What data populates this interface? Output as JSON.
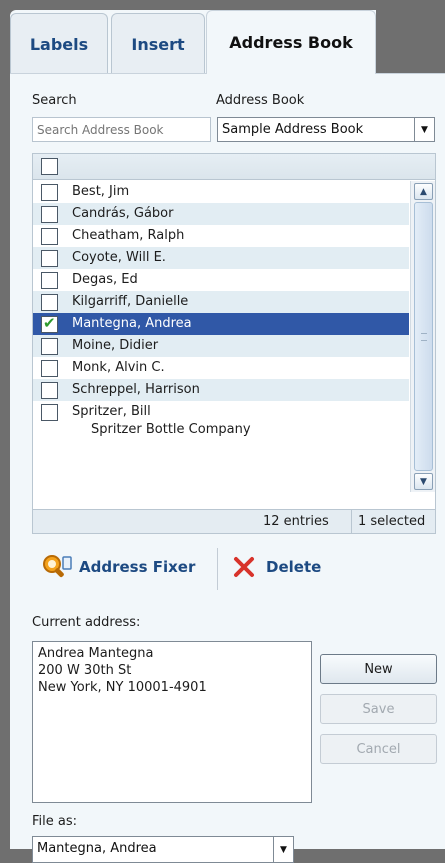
{
  "tabs": [
    {
      "label": "Labels"
    },
    {
      "label": "Insert"
    },
    {
      "label": "Address Book"
    }
  ],
  "search": {
    "label": "Search",
    "placeholder": "Search Address Book"
  },
  "address_book": {
    "label": "Address Book",
    "selected": "Sample Address Book"
  },
  "contacts": [
    {
      "name": "Best, Jim",
      "checked": false
    },
    {
      "name": "Candrás, Gábor",
      "checked": false
    },
    {
      "name": "Cheatham, Ralph",
      "checked": false
    },
    {
      "name": "Coyote, Will E.",
      "checked": false
    },
    {
      "name": "Degas, Ed",
      "checked": false
    },
    {
      "name": "Kilgarriff, Danielle",
      "checked": false
    },
    {
      "name": "Mantegna, Andrea",
      "checked": true
    },
    {
      "name": "Moine, Didier",
      "checked": false
    },
    {
      "name": "Monk, Alvin C.",
      "checked": false
    },
    {
      "name": "Schreppel, Harrison",
      "checked": false
    },
    {
      "name": "Spritzer, Bill",
      "company": "Spritzer Bottle Company",
      "checked": false
    }
  ],
  "list_footer": {
    "entries": "12 entries",
    "selected": "1 selected"
  },
  "actions": {
    "address_fixer": "Address Fixer",
    "delete": "Delete"
  },
  "current_address": {
    "label": "Current address:",
    "lines": [
      "Andrea Mantegna",
      "200 W 30th St",
      "New York, NY 10001-4901"
    ]
  },
  "buttons": {
    "new": "New",
    "save": "Save",
    "cancel": "Cancel"
  },
  "file_as": {
    "label": "File as:",
    "value": "Mantegna, Andrea"
  },
  "colors": {
    "tab_text": "#1d4a82",
    "selected_row": "#3058a7",
    "delete_icon": "#d8332b",
    "fixer_icon": "#e0890f"
  }
}
